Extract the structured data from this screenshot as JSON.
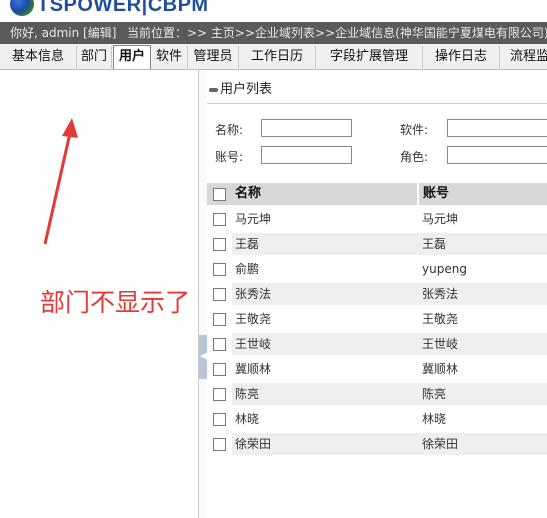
{
  "header": {
    "brand": "TSPOWER|CBPM",
    "user_text": "你好, admin [编辑]",
    "location_text": "当前位置：>> 主页>>企业域列表>>企业域信息(神华国能宁夏煤电有限公司)"
  },
  "tabs": [
    {
      "label": "基本信息",
      "active": false
    },
    {
      "label": "部门",
      "active": false
    },
    {
      "label": "用户",
      "active": true
    },
    {
      "label": "软件",
      "active": false
    },
    {
      "label": "管理员",
      "active": false
    },
    {
      "label": "工作日历",
      "active": false
    },
    {
      "label": "字段扩展管理",
      "active": false
    },
    {
      "label": "操作日志",
      "active": false
    },
    {
      "label": "流程监",
      "active": false
    }
  ],
  "annotation": {
    "text": "部门不显示了",
    "color": "#e53935"
  },
  "panel": {
    "title": "用户列表",
    "filters": {
      "name_label": "名称:",
      "account_label": "账号:",
      "software_label": "软件:",
      "role_label": "角色:"
    },
    "grid": {
      "headers": {
        "name": "名称",
        "account": "账号"
      },
      "rows": [
        {
          "name": "马元坤",
          "account": "马元坤"
        },
        {
          "name": "王磊",
          "account": "王磊"
        },
        {
          "name": "俞鹏",
          "account": "yupeng"
        },
        {
          "name": "张秀法",
          "account": "张秀法"
        },
        {
          "name": "王敬尧",
          "account": "王敬尧"
        },
        {
          "name": "王世岐",
          "account": "王世岐"
        },
        {
          "name": "冀顺林",
          "account": "冀顺林"
        },
        {
          "name": "陈亮",
          "account": "陈亮"
        },
        {
          "name": "林晓",
          "account": "林晓"
        },
        {
          "name": "徐荣田",
          "account": "徐荣田"
        }
      ]
    }
  },
  "icons": {
    "splitter": "chevron-left-icon",
    "title": "dash-icon",
    "logo": "globe-icon"
  }
}
